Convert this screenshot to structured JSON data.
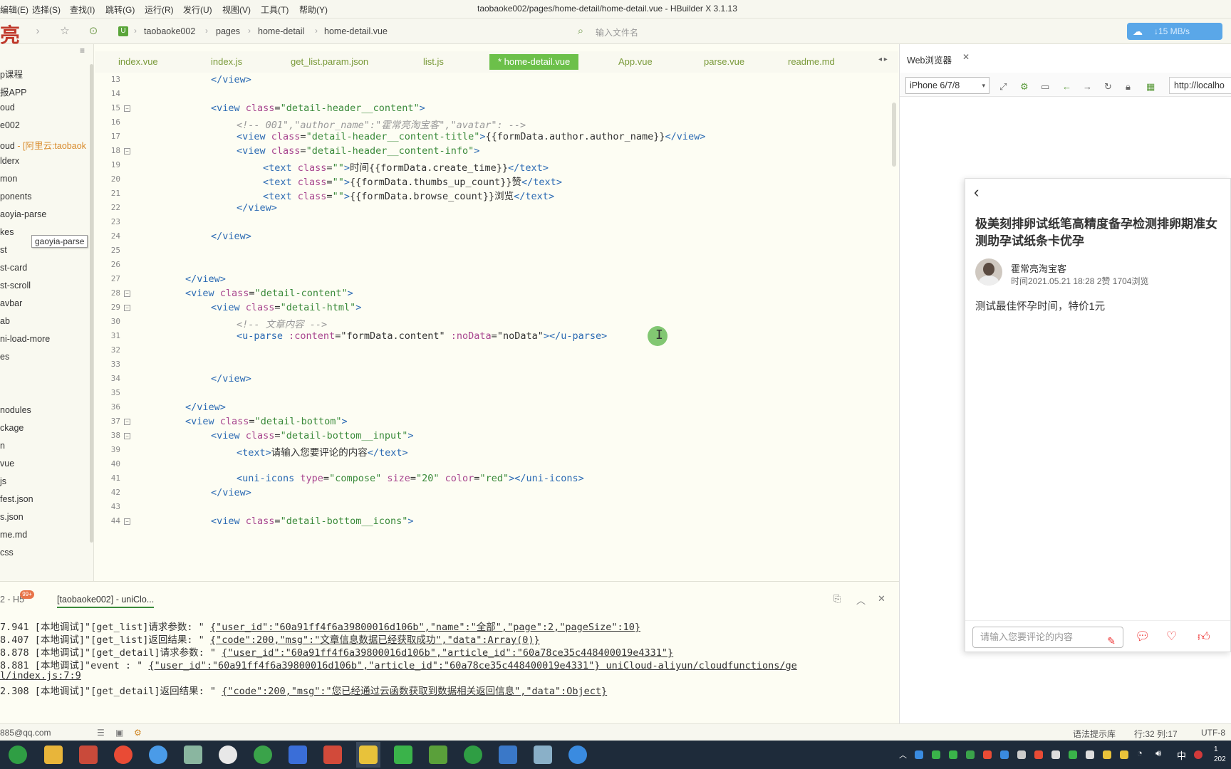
{
  "window": {
    "title": "taobaoke002/pages/home-detail/home-detail.vue - HBuilder X 3.1.13",
    "menu": [
      "编辑(E)",
      "选择(S)",
      "查找(I)",
      "跳转(G)",
      "运行(R)",
      "发行(U)",
      "视图(V)",
      "工具(T)",
      "帮助(Y)"
    ]
  },
  "toolbar": {
    "logo_char": "亮",
    "breadcrumb": [
      "taobaoke002",
      "pages",
      "home-detail",
      "home-detail.vue"
    ],
    "file_search_placeholder": "输入文件名",
    "speed": "↓15 MB/s"
  },
  "sidebar": {
    "items": [
      "p课程",
      "报APP",
      "oud",
      "e002",
      "oud",
      "lderx",
      "mon",
      "ponents",
      "aoyia-parse",
      "kes",
      "st",
      "st-card",
      "st-scroll",
      "avbar",
      "ab",
      "ni-load-more",
      "es",
      "",
      "",
      "nodules",
      "ckage",
      "n",
      "vue",
      "js",
      "fest.json",
      "s.json",
      "me.md",
      "css"
    ],
    "cloud_label": "- [阿里云:taobaok",
    "tooltip": "gaoyia-parse"
  },
  "tabs": [
    "index.vue",
    "index.js",
    "get_list.param.json",
    "list.js",
    "* home-detail.vue",
    "App.vue",
    "parse.vue",
    "readme.md"
  ],
  "editor": {
    "line_numbers": [
      "13",
      "14",
      "15",
      "16",
      "17",
      "18",
      "19",
      "20",
      "21",
      "22",
      "23",
      "24",
      "25",
      "26",
      "27",
      "28",
      "29",
      "30",
      "31",
      "32",
      "33",
      "34",
      "35",
      "36",
      "37",
      "38",
      "39",
      "40",
      "41",
      "42",
      "43",
      "44"
    ]
  },
  "console": {
    "tab1": "2 - H5",
    "badge": "99+",
    "tab2": "[taobaoke002] - uniClo...",
    "lines": [
      [
        "7.941 [本地调试]\"[get_list]请求参数: \" ",
        "{\"user_id\":\"60a91ff4f6a39800016d106b\",\"name\":\"全部\",\"page\":2,\"pageSize\":10}",
        ""
      ],
      [
        "8.407 [本地调试]\"[get_list]返回结果: \" ",
        "{\"code\":200,\"msg\":\"文章信息数据已经获取成功\",\"data\":Array(0)}",
        ""
      ],
      [
        "8.878 [本地调试]\"[get_detail]请求参数: \" ",
        "{\"user_id\":\"60a91ff4f6a39800016d106b\",\"article_id\":\"60a78ce35c448400019e4331\"}",
        ""
      ],
      [
        "8.881 [本地调试]\"event : \" ",
        "{\"user_id\":\"60a91ff4f6a39800016d106b\",\"article_id\":\"60a78ce35c448400019e4331\"}",
        " uniCloud-aliyun/cloudfunctions/ge"
      ],
      [
        "",
        "l/index.js:7:9",
        ""
      ],
      [
        "2.308 [本地调试]\"[get_detail]返回结果: \" ",
        "{\"code\":200,\"msg\":\"您已经通过云函数获取到数据相关返回信息\",\"data\":Object}",
        ""
      ]
    ]
  },
  "status": {
    "email": "885@qq.com",
    "hint": "语法提示库",
    "position": "行:32  列:17",
    "encoding": "UTF-8"
  },
  "browser": {
    "tab_label": "Web浏览器",
    "device": "iPhone 6/7/8",
    "url": "http://localho"
  },
  "phone": {
    "title": "极美刻排卵试纸笔高精度备孕检测排卵期准女测助孕试纸条卡优孕",
    "author": "霍常亮淘宝客",
    "meta": "时间2021.05.21 18:28   2赞   1704浏览",
    "content": "测试最佳怀孕时间，特价1元",
    "comment_placeholder": "请输入您要评论的内容"
  },
  "taskbar": {
    "ime": "中",
    "time_top": "1",
    "time_bottom": "202"
  }
}
